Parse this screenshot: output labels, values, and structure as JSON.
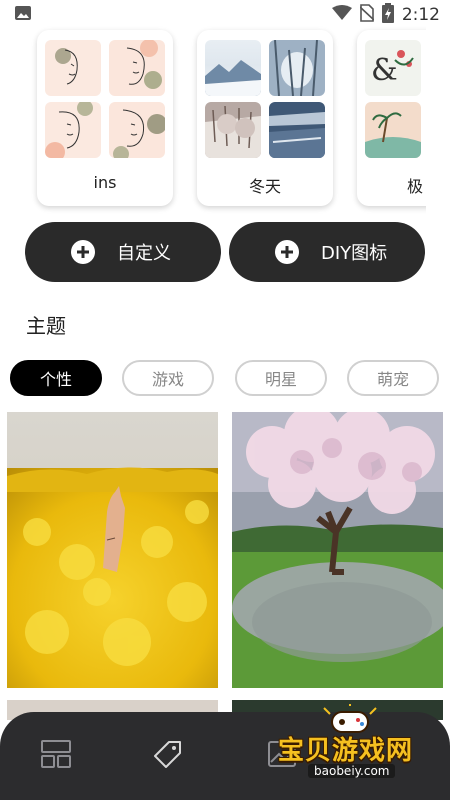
{
  "status_bar": {
    "time": "2:12",
    "icons": [
      "image-icon",
      "wifi-icon",
      "no-sim-icon",
      "battery-charging-icon"
    ]
  },
  "icon_packs": [
    {
      "name": "ins"
    },
    {
      "name": "冬天"
    },
    {
      "name": "极"
    }
  ],
  "actions": {
    "custom_label": "自定义",
    "diy_label": "DIY图标"
  },
  "themes_section": {
    "title": "主题",
    "categories": [
      "个性",
      "游戏",
      "明星",
      "萌宠"
    ],
    "selected_category": "个性"
  },
  "bottom_nav": {
    "items": [
      "layout-grid-icon",
      "tag-icon",
      "image-icon"
    ]
  },
  "watermark": {
    "title": "宝贝游戏网",
    "url": "baobeiy.com"
  },
  "colors": {
    "button_dark": "#2a2a2a",
    "chip_active": "#000000",
    "chip_border": "#d0d0d0",
    "nav_background": "#2c2c2e",
    "watermark_yellow": "#f5c020"
  }
}
